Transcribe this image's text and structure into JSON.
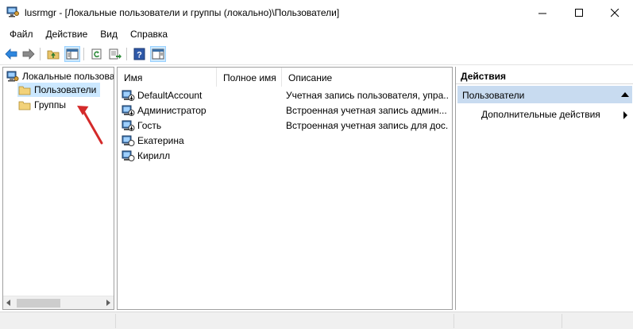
{
  "window": {
    "title": "lusrmgr - [Локальные пользователи и группы (локально)\\Пользователи]",
    "app_icon": "computer-management-icon"
  },
  "menu": [
    "Файл",
    "Действие",
    "Вид",
    "Справка"
  ],
  "toolbar": {
    "buttons": [
      "back-arrow-icon",
      "forward-arrow-icon",
      "up-folder-icon",
      "show-hide-tree-icon",
      "refresh-icon",
      "export-list-icon",
      "help-icon",
      "show-hide-action-pane-icon"
    ]
  },
  "tree": {
    "root_label": "Локальные пользова",
    "items": [
      {
        "label": "Пользователи",
        "selected": true
      },
      {
        "label": "Группы",
        "selected": false
      }
    ]
  },
  "list": {
    "columns": [
      "Имя",
      "Полное имя",
      "Описание"
    ],
    "rows": [
      {
        "name": "DefaultAccount",
        "full_name": "",
        "description": "Учетная запись пользователя, упра...",
        "disabled": true
      },
      {
        "name": "Администратор",
        "full_name": "",
        "description": "Встроенная учетная запись админ...",
        "disabled": true
      },
      {
        "name": "Гость",
        "full_name": "",
        "description": "Встроенная учетная запись для дос...",
        "disabled": true
      },
      {
        "name": "Екатерина",
        "full_name": "",
        "description": "",
        "disabled": false
      },
      {
        "name": "Кирилл",
        "full_name": "",
        "description": "",
        "disabled": false
      }
    ]
  },
  "actions": {
    "title": "Действия",
    "section": "Пользователи",
    "items": [
      "Дополнительные действия"
    ]
  },
  "colors": {
    "selection": "#cce8ff",
    "action_header": "#c8dbf0",
    "annotation_arrow": "#d42a2a"
  }
}
